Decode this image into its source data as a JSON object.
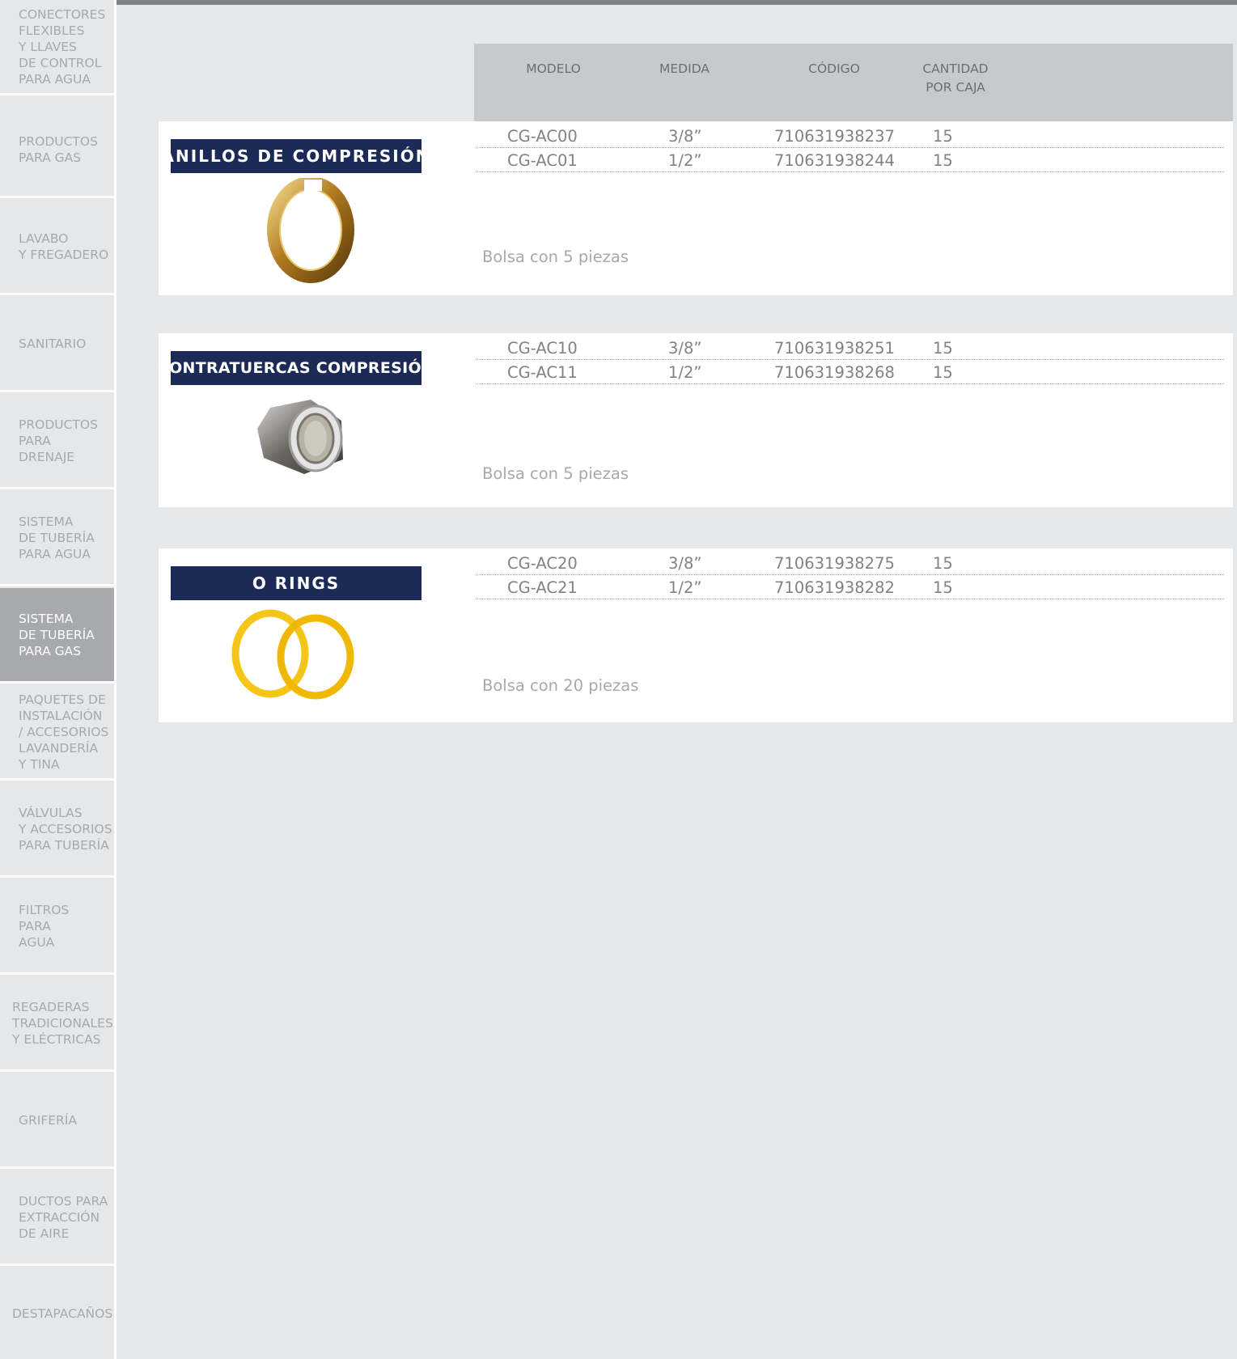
{
  "sidebar": {
    "items": [
      {
        "label": "CONECTORES\nFLEXIBLES\nY LLAVES\nDE CONTROL\nPARA AGUA"
      },
      {
        "label": "PRODUCTOS\nPARA GAS"
      },
      {
        "label": "LAVABO\nY FREGADERO"
      },
      {
        "label": "SANITARIO"
      },
      {
        "label": "PRODUCTOS\nPARA\nDRENAJE"
      },
      {
        "label": "SISTEMA\nDE TUBERÍA\nPARA AGUA"
      },
      {
        "label": "SISTEMA\nDE TUBERÍA\nPARA GAS"
      },
      {
        "label": "PAQUETES DE\nINSTALACIÓN\n/ ACCESORIOS\nLAVANDERÍA\nY TINA"
      },
      {
        "label": "VÁLVULAS\nY ACCESORIOS\nPARA TUBERÍA"
      },
      {
        "label": "FILTROS\nPARA\nAGUA"
      },
      {
        "label": "REGADERAS\nTRADICIONALES\nY ELÉCTRICAS"
      },
      {
        "label": "GRIFERÍA"
      },
      {
        "label": "DUCTOS PARA\nEXTRACCIÓN\nDE AIRE"
      },
      {
        "label": "DESTAPACAÑOS"
      }
    ]
  },
  "table_header": {
    "modelo": "MODELO",
    "medida": "MEDIDA",
    "codigo": "CÓDIGO",
    "cantidad": "CANTIDAD\nPOR CAJA"
  },
  "products": [
    {
      "title": "ANILLOS DE COMPRESIÓN",
      "image_icon": "brass-compression-ring-icon",
      "rows": [
        {
          "modelo": "CG-AC00",
          "medida": "3/8”",
          "codigo": "710631938237",
          "cantidad": "15"
        },
        {
          "modelo": "CG-AC01",
          "medida": "1/2”",
          "codigo": "710631938244",
          "cantidad": "15"
        }
      ],
      "note": "Bolsa con 5 piezas"
    },
    {
      "title": "CONTRATUERCAS COMPRESIÓN",
      "image_icon": "chrome-locknut-icon",
      "rows": [
        {
          "modelo": "CG-AC10",
          "medida": "3/8”",
          "codigo": "710631938251",
          "cantidad": "15"
        },
        {
          "modelo": "CG-AC11",
          "medida": "1/2”",
          "codigo": "710631938268",
          "cantidad": "15"
        }
      ],
      "note": "Bolsa con 5 piezas"
    },
    {
      "title": "O RINGS",
      "image_icon": "yellow-o-rings-icon",
      "rows": [
        {
          "modelo": "CG-AC20",
          "medida": "3/8”",
          "codigo": "710631938275",
          "cantidad": "15"
        },
        {
          "modelo": "CG-AC21",
          "medida": "1/2”",
          "codigo": "710631938282",
          "cantidad": "15"
        }
      ],
      "note": "Bolsa con 20 piezas"
    }
  ],
  "colors": {
    "background": "#e6e7e8",
    "title_box": "#1b2a57",
    "sidebar_active": "#a7a9ac",
    "header_band": "#c8c9cb"
  }
}
